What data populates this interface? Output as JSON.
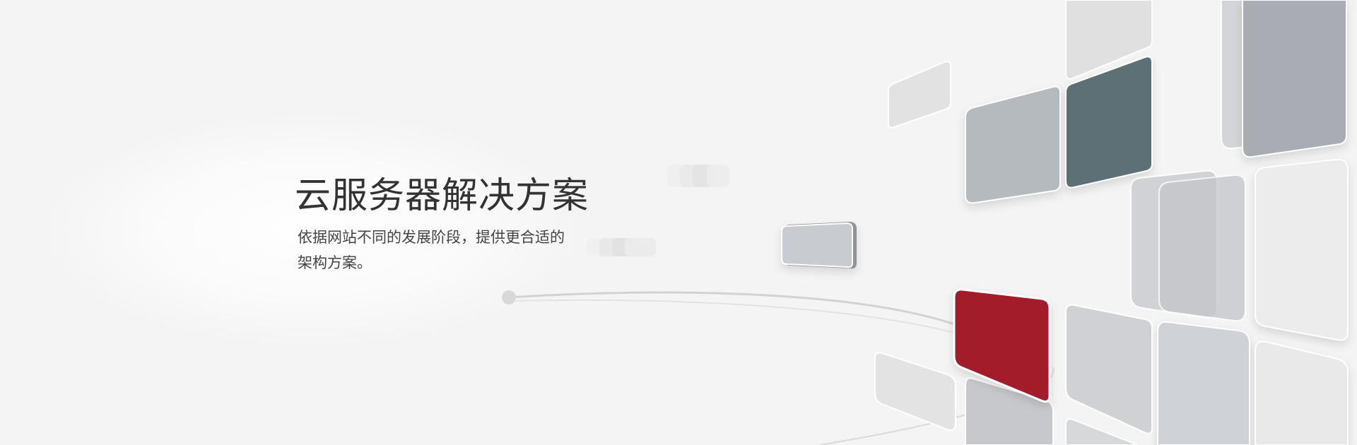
{
  "banner": {
    "title": "云服务器解决方案",
    "description_lines": [
      "依据网站不同的发展阶段，提供更合适的",
      "架构方案。"
    ]
  },
  "colors": {
    "background": "#f4f4f4",
    "title_text": "#333333",
    "body_text": "#444444",
    "accent_red": "#a21e2c",
    "accent_slate": "#5d6f76",
    "tile_grey": "#b6bbc2",
    "tile_light": "#dedede"
  },
  "decoration": {
    "style": "3d floating rounded tiles with orbit lines"
  }
}
